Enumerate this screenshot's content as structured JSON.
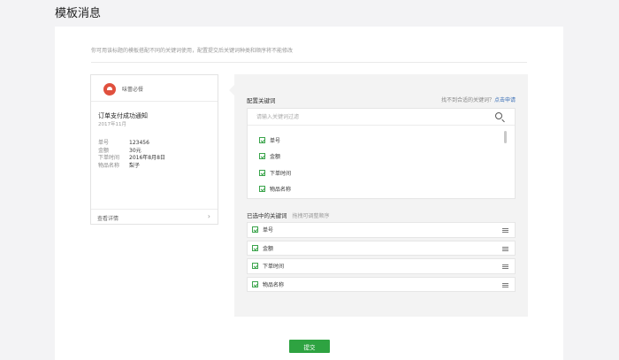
{
  "page": {
    "title": "模板消息",
    "description": "你可用该标题的模板搭配不同的关键词使用，配置提交后关键词种类和顺序将不能修改"
  },
  "message_card": {
    "account_name": "味蕾必餐",
    "title": "订单支付成功通知",
    "date": "2017年11月",
    "rows": [
      {
        "key": "单号",
        "value": "123456"
      },
      {
        "key": "金额",
        "value": "30元"
      },
      {
        "key": "下单时间",
        "value": "2016年8月8日"
      },
      {
        "key": "物品名称",
        "value": "梨子"
      }
    ],
    "details_label": "查看详情",
    "chevron": "›"
  },
  "config": {
    "label": "配置关键词",
    "hint": "找不到合适的关键词？",
    "hint_link": "点击申请",
    "search_placeholder": "请输入关键词过滤",
    "keywords": [
      "单号",
      "金额",
      "下单时间",
      "物品名称"
    ],
    "selected_label": "已选中的关键词",
    "selected_sub": "拖拽可调整顺序",
    "selected": [
      "单号",
      "金额",
      "下单时间",
      "物品名称"
    ]
  },
  "submit_label": "提交",
  "colors": {
    "accent": "#2ea341",
    "link": "#3b6fb6",
    "logo": "#e0503e"
  }
}
